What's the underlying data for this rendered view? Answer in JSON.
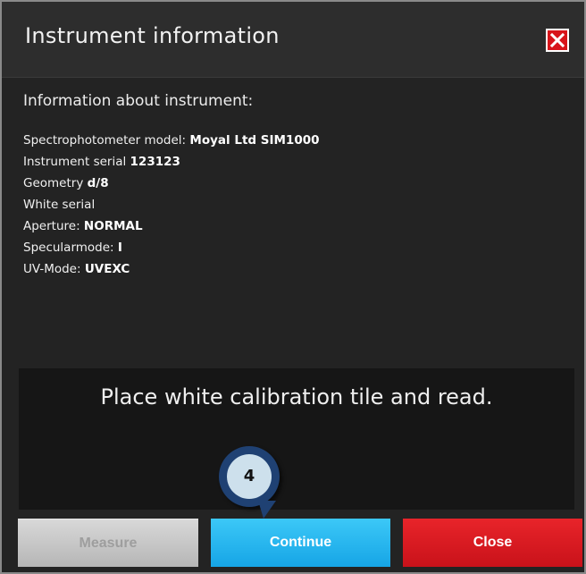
{
  "dialog": {
    "title": "Instrument information",
    "close_icon": "close-icon"
  },
  "info": {
    "heading": "Information about instrument:",
    "items": [
      {
        "label": "Spectrophotometer model: ",
        "value": "Moyal Ltd SIM1000"
      },
      {
        "label": "Instrument serial ",
        "value": "123123"
      },
      {
        "label": "Geometry ",
        "value": "d/8"
      },
      {
        "label": "White serial",
        "value": ""
      },
      {
        "label": "Aperture: ",
        "value": "NORMAL"
      },
      {
        "label": "Specularmode: ",
        "value": "I"
      },
      {
        "label": "UV-Mode: ",
        "value": "UVEXC"
      }
    ]
  },
  "message": "Place white calibration tile and read.",
  "step_badge": "4",
  "buttons": {
    "measure": "Measure",
    "continue": "Continue",
    "close": "Close"
  },
  "colors": {
    "background": "#232323",
    "close_red": "#d8141a",
    "continue_blue": "#1fb0ee",
    "close_button_red": "#dc1d24",
    "measure_disabled": "#c8c8c8",
    "badge_navy": "#1f4173"
  }
}
